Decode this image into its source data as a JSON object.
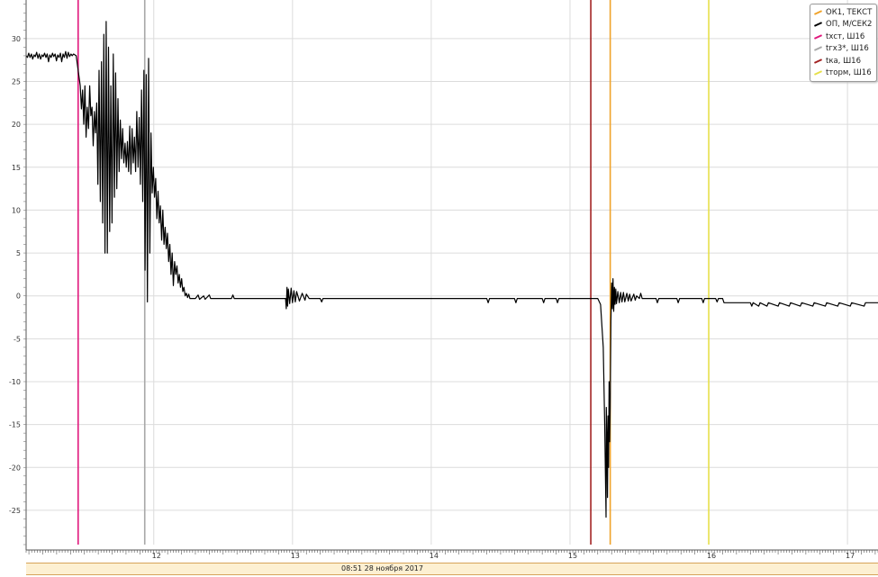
{
  "chart_data": {
    "type": "line",
    "title": "",
    "xlabel": "",
    "ylabel": "",
    "xlim": [
      11.08,
      17.22
    ],
    "ylim": [
      -29,
      34.5
    ],
    "x_ticks": [
      12,
      13,
      14,
      15,
      16,
      17
    ],
    "y_ticks": [
      30,
      25,
      20,
      15,
      10,
      5,
      0,
      -5,
      -10,
      -15,
      -20,
      -25
    ],
    "grid": true,
    "legend_position": "top-right",
    "legend": [
      {
        "name": "ОК1, ТЕКСТ",
        "color": "#f0a32a"
      },
      {
        "name": "ОП, М/СЕК2",
        "color": "#000000"
      },
      {
        "name": "tхст, Ш16",
        "color": "#e0177c"
      },
      {
        "name": "tгх3*, Ш16",
        "color": "#a8a8a8"
      },
      {
        "name": "tка, Ш16",
        "color": "#a32323"
      },
      {
        "name": "tторм, Ш16",
        "color": "#e6e04a"
      }
    ],
    "markers": [
      {
        "name": "tхст, Ш16",
        "x": 11.455,
        "color": "#e0177c"
      },
      {
        "name": "tгх3*, Ш16",
        "x": 11.935,
        "color": "#a8a8a8"
      },
      {
        "name": "tка, Ш16",
        "x": 15.15,
        "color": "#a32323"
      },
      {
        "name": "ОК1, ТЕКСТ",
        "x": 15.29,
        "color": "#f0a32a"
      },
      {
        "name": "tторм, Ш16",
        "x": 16.0,
        "color": "#e6e04a"
      }
    ],
    "series": [
      {
        "name": "ОП, М/СЕК2",
        "color": "#000000",
        "segments": [
          {
            "x0": 11.08,
            "dx": 0.0095,
            "y": [
              28,
              27.8,
              28.3,
              27.8,
              28.2,
              27.6,
              28.1,
              27.9,
              28.4,
              27.7,
              28.2,
              27.6,
              28.1,
              27.9,
              28.3,
              27.8,
              28.2,
              27.3,
              28.1,
              27.8,
              28.3,
              27.9,
              28.2,
              27.4,
              28.1,
              27.8,
              28.3,
              27.3,
              28.2,
              27.8,
              28.5,
              27.7,
              28.4,
              27.9,
              28.2,
              28.0,
              28.2,
              28.1,
              28.0
            ]
          },
          {
            "x0": 11.47,
            "dx": 0.0085,
            "y": [
              24.5,
              21.8,
              24,
              20,
              24.5,
              18.5,
              22,
              19.5,
              24.5,
              21,
              22,
              17.5,
              21.5,
              19,
              22.5,
              13,
              26.3,
              11,
              27.3,
              8.5,
              30.5,
              5,
              32,
              5,
              29,
              7.5,
              24.5,
              8.5,
              28.2,
              11.5,
              26,
              12.5,
              23,
              14.5,
              20.5,
              16,
              19.5,
              15.5,
              17.8,
              15,
              18,
              14.5,
              19.8,
              14.2,
              19.5,
              15.5,
              18.5,
              14.5,
              21.5,
              15,
              20.8,
              13,
              24,
              11,
              26.3,
              3,
              25.8,
              -0.7,
              27.7,
              5,
              19,
              12,
              15,
              11.5,
              13.7,
              9,
              12.2,
              8.5,
              10.5,
              6.5,
              10,
              6,
              8,
              5.5,
              7.3,
              4,
              6,
              2.5,
              5,
              1.2,
              4,
              2.5,
              3.5,
              1.5,
              2.5,
              1,
              2,
              0.5,
              1,
              0,
              0.3,
              -0.2,
              0.2,
              -0.3
            ]
          }
        ],
        "points": [
          [
            12.3,
            -0.3
          ],
          [
            12.32,
            0.1
          ],
          [
            12.33,
            -0.4
          ],
          [
            12.36,
            0
          ],
          [
            12.37,
            -0.4
          ],
          [
            12.4,
            0.1
          ],
          [
            12.41,
            -0.3
          ],
          [
            12.56,
            -0.3
          ],
          [
            12.57,
            0.1
          ],
          [
            12.58,
            -0.3
          ],
          [
            12.95,
            -0.3
          ],
          [
            12.955,
            -1.5
          ],
          [
            12.96,
            1
          ],
          [
            12.965,
            -1.2
          ],
          [
            12.97,
            0.8
          ],
          [
            12.98,
            -0.9
          ],
          [
            12.99,
            0.9
          ],
          [
            13.0,
            -0.8
          ],
          [
            13.01,
            0.6
          ],
          [
            13.02,
            -0.7
          ],
          [
            13.03,
            0.5
          ],
          [
            13.05,
            -0.6
          ],
          [
            13.07,
            0.3
          ],
          [
            13.09,
            -0.5
          ],
          [
            13.1,
            0.2
          ],
          [
            13.12,
            -0.3
          ],
          [
            13.2,
            -0.3
          ],
          [
            13.21,
            -0.7
          ],
          [
            13.22,
            -0.3
          ],
          [
            14.4,
            -0.3
          ],
          [
            14.41,
            -0.8
          ],
          [
            14.42,
            -0.3
          ],
          [
            14.6,
            -0.3
          ],
          [
            14.61,
            -0.8
          ],
          [
            14.62,
            -0.3
          ],
          [
            14.8,
            -0.3
          ],
          [
            14.81,
            -0.8
          ],
          [
            14.82,
            -0.3
          ],
          [
            14.9,
            -0.3
          ],
          [
            14.91,
            -0.8
          ],
          [
            14.92,
            -0.3
          ],
          [
            15.2,
            -0.3
          ],
          [
            15.22,
            -1
          ],
          [
            15.24,
            -6
          ],
          [
            15.25,
            -15
          ],
          [
            15.26,
            -25.8
          ],
          [
            15.262,
            -13
          ],
          [
            15.266,
            -16
          ],
          [
            15.27,
            -23.5
          ],
          [
            15.274,
            -14
          ],
          [
            15.278,
            -20
          ],
          [
            15.282,
            -10
          ],
          [
            15.286,
            -17
          ],
          [
            15.29,
            -13
          ],
          [
            15.295,
            -3
          ],
          [
            15.3,
            1.5
          ],
          [
            15.305,
            -1.5
          ],
          [
            15.31,
            2
          ],
          [
            15.315,
            -1.8
          ],
          [
            15.32,
            1
          ],
          [
            15.325,
            -1
          ],
          [
            15.33,
            0.8
          ],
          [
            15.335,
            -0.9
          ],
          [
            15.345,
            0.5
          ],
          [
            15.355,
            -0.8
          ],
          [
            15.365,
            0.4
          ],
          [
            15.375,
            -0.7
          ],
          [
            15.385,
            0.4
          ],
          [
            15.395,
            -0.7
          ],
          [
            15.41,
            0.3
          ],
          [
            15.42,
            -0.6
          ],
          [
            15.43,
            0.2
          ],
          [
            15.44,
            -0.6
          ],
          [
            15.46,
            0.2
          ],
          [
            15.47,
            -0.5
          ],
          [
            15.48,
            0
          ],
          [
            15.5,
            -0.3
          ],
          [
            15.51,
            0.3
          ],
          [
            15.52,
            -0.3
          ],
          [
            15.62,
            -0.3
          ],
          [
            15.63,
            -0.8
          ],
          [
            15.64,
            -0.3
          ],
          [
            15.77,
            -0.3
          ],
          [
            15.78,
            -0.8
          ],
          [
            15.79,
            -0.3
          ],
          [
            15.95,
            -0.3
          ],
          [
            15.96,
            -0.8
          ],
          [
            15.97,
            -0.3
          ],
          [
            16.05,
            -0.3
          ],
          [
            16.06,
            -0.7
          ],
          [
            16.07,
            -0.3
          ],
          [
            16.1,
            -0.3
          ],
          [
            16.11,
            -0.8
          ],
          [
            16.3,
            -0.8
          ],
          [
            16.31,
            -1.2
          ],
          [
            16.32,
            -0.8
          ],
          [
            16.36,
            -1.2
          ],
          [
            16.37,
            -0.8
          ],
          [
            16.42,
            -1.2
          ],
          [
            16.43,
            -0.8
          ],
          [
            16.5,
            -1.2
          ],
          [
            16.51,
            -0.8
          ],
          [
            16.58,
            -1.2
          ],
          [
            16.59,
            -0.8
          ],
          [
            16.66,
            -1.2
          ],
          [
            16.67,
            -0.8
          ],
          [
            16.75,
            -1.2
          ],
          [
            16.76,
            -0.8
          ],
          [
            16.84,
            -1.2
          ],
          [
            16.85,
            -0.8
          ],
          [
            16.93,
            -1.2
          ],
          [
            16.94,
            -0.8
          ],
          [
            17.02,
            -1.2
          ],
          [
            17.03,
            -0.8
          ],
          [
            17.12,
            -1.2
          ],
          [
            17.13,
            -0.8
          ],
          [
            17.22,
            -0.8
          ]
        ]
      }
    ]
  },
  "footer": {
    "date_label": "08:51 28 ноября 2017"
  }
}
